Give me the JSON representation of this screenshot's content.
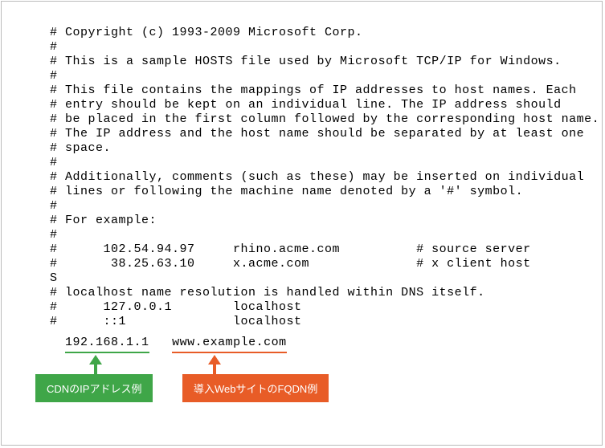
{
  "hosts_file": {
    "lines": [
      "# Copyright (c) 1993-2009 Microsoft Corp.",
      "#",
      "# This is a sample HOSTS file used by Microsoft TCP/IP for Windows.",
      "#",
      "# This file contains the mappings of IP addresses to host names. Each",
      "# entry should be kept on an individual line. The IP address should",
      "# be placed in the first column followed by the corresponding host name.",
      "# The IP address and the host name should be separated by at least one",
      "# space.",
      "#",
      "# Additionally, comments (such as these) may be inserted on individual",
      "# lines or following the machine name denoted by a '#' symbol.",
      "#",
      "# For example:",
      "#",
      "#      102.54.94.97     rhino.acme.com          # source server",
      "#       38.25.63.10     x.acme.com              # x client host",
      "S",
      "# localhost name resolution is handled within DNS itself.",
      "#      127.0.0.1        localhost",
      "#      ::1              localhost"
    ]
  },
  "entry": {
    "ip": "192.168.1.1",
    "fqdn": "www.example.com"
  },
  "callouts": {
    "ip_label": "CDNのIPアドレス例",
    "fqdn_label": "導入WebサイトのFQDN例"
  }
}
